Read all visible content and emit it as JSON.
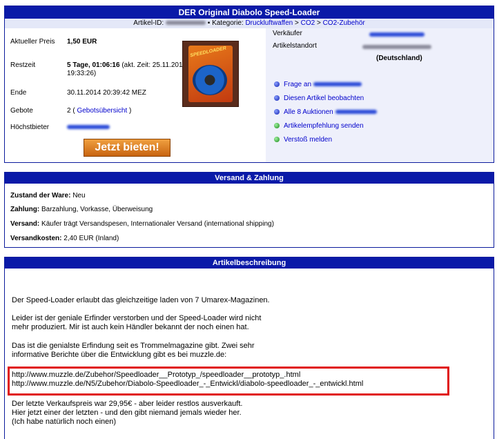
{
  "header": {
    "title": "DER Original Diabolo Speed-Loader",
    "article_id_label": "Artikel-ID:",
    "category_label": "Kategorie:",
    "breadcrumb": [
      "Druckluftwaffen",
      "CO2",
      "CO2-Zubehör"
    ],
    "breadcrumb_sep": ">"
  },
  "auction": {
    "current_price_label": "Aktueller Preis",
    "current_price": "1,50 EUR",
    "time_left_label": "Restzeit",
    "time_left": "5 Tage, 01:06:16",
    "time_left_note": "(akt. Zeit: 25.11.2014 19:33:26)",
    "end_label": "Ende",
    "end_value": "30.11.2014 20:39:42 MEZ",
    "bids_label": "Gebote",
    "bids_count": "2",
    "bids_link": "Gebotsübersicht",
    "high_bidder_label": "Höchstbieter",
    "bid_button": "Jetzt bieten!"
  },
  "product_image": {
    "brand_text": "SPEEDLOADER"
  },
  "seller": {
    "seller_label": "Verkäufer",
    "location_label": "Artikelstandort",
    "country": "(Deutschland)",
    "actions": [
      {
        "label": "Frage an",
        "icon": "blue-dot"
      },
      {
        "label": "Diesen Artikel beobachten",
        "icon": "blue-dot"
      },
      {
        "label": "Alle 8 Auktionen",
        "icon": "blue-dot"
      },
      {
        "label": "Artikelempfehlung senden",
        "icon": "green-dot"
      },
      {
        "label": "Verstoß melden",
        "icon": "green-dot"
      }
    ]
  },
  "shipping": {
    "title": "Versand & Zahlung",
    "rows": [
      {
        "label": "Zustand der Ware:",
        "value": "Neu"
      },
      {
        "label": "Zahlung:",
        "value": "Barzahlung, Vorkasse, Überweisung"
      },
      {
        "label": "Versand:",
        "value": "Käufer trägt Versandspesen, Internationaler Versand (international shipping)"
      },
      {
        "label": "Versandkosten:",
        "value": "2,40 EUR (Inland)"
      }
    ]
  },
  "description": {
    "title": "Artikelbeschreibung",
    "p1": "Der Speed-Loader erlaubt das gleichzeitige laden von 7 Umarex-Magazinen.",
    "p2a": "Leider ist der geniale Erfinder verstorben und der Speed-Loader wird nicht",
    "p2b": "mehr produziert. Mir ist auch kein Händler bekannt der noch einen hat.",
    "p3a": "Das ist die genialste Erfindung seit es Trommelmagazine gibt. Zwei sehr",
    "p3b": "informative Berichte über die Entwicklung gibt es bei muzzle.de:",
    "url1": "http://www.muzzle.de/Zubehor/Speedloader__Prototyp_/speedloader__prototyp_.html",
    "url2": "http://www.muzzle.de/N5/Zubehor/Diabolo-Speedloader_-_Entwickl/diabolo-speedloader_-_entwickl.html",
    "p4a": "Der letzte Verkaufspreis war 29,95€ - aber leider restlos ausverkauft.",
    "p4b": "Hier jetzt einer der letzten - und den gibt niemand jemals wieder her.",
    "p4c": "(Ich habe natürlich noch einen)"
  },
  "colors": {
    "bar": "#0a1aa8",
    "highlight": "#e01010",
    "button": "#e08020"
  }
}
